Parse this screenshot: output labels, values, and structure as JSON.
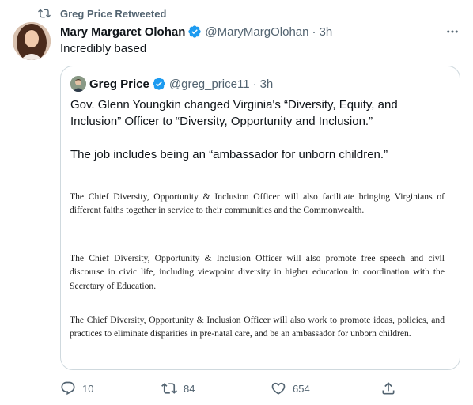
{
  "retweet": {
    "label": "Greg Price Retweeted"
  },
  "tweet": {
    "display_name": "Mary Margaret Olohan",
    "handle": "@MaryMargOlohan",
    "separator": "·",
    "time": "3h",
    "text": "Incredibly based"
  },
  "quote": {
    "display_name": "Greg Price",
    "handle": "@greg_price11",
    "separator": "·",
    "time": "3h",
    "text_para1": "Gov. Glenn Youngkin changed Virginia's “Diversity, Equity, and Inclusion” Officer to “Diversity, Opportunity and Inclusion.”",
    "text_para2": "The job includes being an “ambassador for unborn children.”",
    "document": {
      "para1": "The Chief Diversity, Opportunity & Inclusion Officer will also facilitate bringing Virginians of different faiths together in service to their communities and the Commonwealth.",
      "para2": "The Chief Diversity, Opportunity & Inclusion Officer will also promote free speech and civil discourse in civic life, including viewpoint diversity in higher education in coordination with the Secretary of Education.",
      "para3": "The Chief Diversity, Opportunity & Inclusion Officer will also work to promote ideas, policies, and practices to eliminate disparities in pre-natal care, and be an ambassador for unborn children."
    }
  },
  "actions": {
    "reply_count": "10",
    "retweet_count": "84",
    "like_count": "654"
  },
  "colors": {
    "text_primary": "#0f1419",
    "text_secondary": "#536471",
    "verified_blue": "#1d9bf0",
    "border": "#cfd9de"
  },
  "icons": {
    "retweet": "retweet-icon",
    "verified": "verified-badge-icon",
    "more": "more-dots-icon",
    "reply": "reply-icon",
    "like": "heart-icon",
    "share": "share-icon"
  }
}
